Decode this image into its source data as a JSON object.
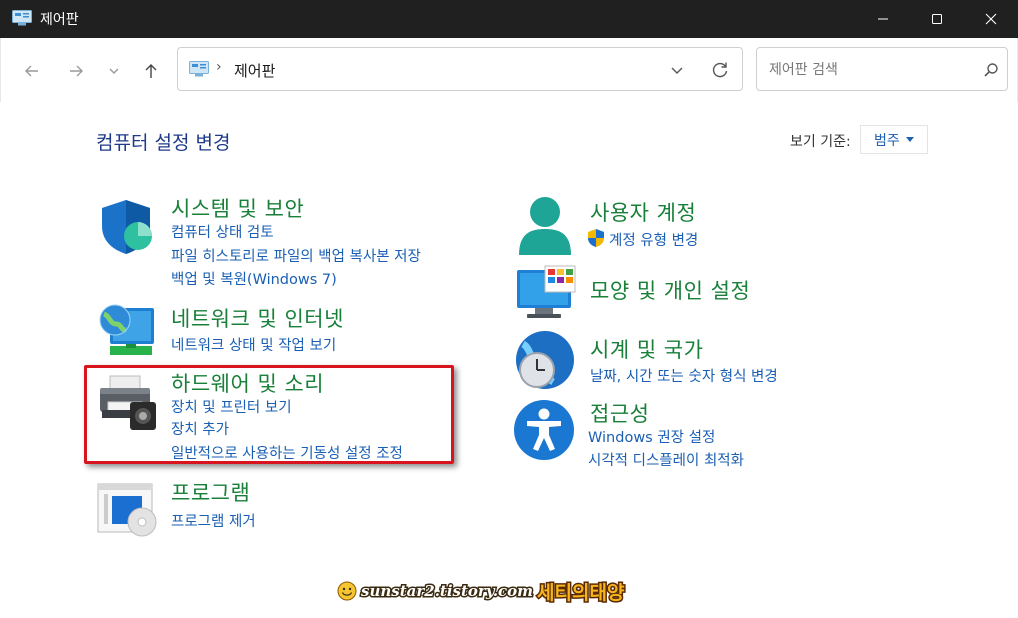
{
  "window": {
    "title": "제어판"
  },
  "nav": {
    "address_path": "제어판",
    "address_separator": "›",
    "search_placeholder": "제어판 검색"
  },
  "main": {
    "heading": "컴퓨터 설정 변경",
    "view_by_label": "보기 기준:",
    "view_by_value": "범주"
  },
  "categories": [
    {
      "title": "시스템 및 보안",
      "icon": "shield-icon",
      "links": [
        "컴퓨터 상태 검토",
        "파일 히스토리로 파일의 백업 복사본 저장",
        "백업 및 복원(Windows 7)"
      ]
    },
    {
      "title": "네트워크 및 인터넷",
      "icon": "network-icon",
      "links": [
        "네트워크 상태 및 작업 보기"
      ]
    },
    {
      "title": "하드웨어 및 소리",
      "icon": "printer-icon",
      "links": [
        "장치 및 프린터 보기",
        "장치 추가",
        "일반적으로 사용하는 기동성 설정 조정"
      ]
    },
    {
      "title": "프로그램",
      "icon": "programs-icon",
      "links": [
        "프로그램 제거"
      ]
    },
    {
      "title": "사용자 계정",
      "icon": "user-icon",
      "links": [
        "계정 유형 변경"
      ]
    },
    {
      "title": "모양 및 개인 설정",
      "icon": "monitor-icon",
      "links": []
    },
    {
      "title": "시계 및 국가",
      "icon": "clock-globe-icon",
      "links": [
        "날짜, 시간 또는 숫자 형식 변경"
      ]
    },
    {
      "title": "접근성",
      "icon": "accessibility-icon",
      "links": [
        "Windows 권장 설정",
        "시각적 디스플레이 최적화"
      ]
    }
  ],
  "watermark": {
    "url": "sunstar2.tistory.com",
    "name": "세티의태양"
  },
  "colors": {
    "title_bar": "#202020",
    "category_title": "#19803a",
    "link": "#1a5fb4",
    "heading": "#1e3a8a",
    "highlight_box": "#d8151e"
  }
}
